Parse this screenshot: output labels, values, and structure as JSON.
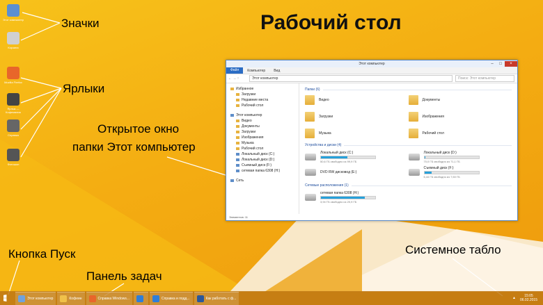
{
  "title": "Рабочий стол",
  "callouts": {
    "icons": "Значки",
    "shortcuts": "Ярлыки",
    "window_line1": "Открытое окно",
    "window_line2": "папки Этот компьютер",
    "start_button": "Кнопка Пуск",
    "taskbar": "Панель задач",
    "tray": "Системное табло"
  },
  "desktop_icons": [
    {
      "label": "Этот компьютер",
      "icon": "computer-icon",
      "color": "#5b8fd1"
    },
    {
      "label": "Корзина",
      "icon": "trash-icon",
      "color": "#d0d0d0"
    },
    {
      "label": "Mozilla Firefox",
      "icon": "firefox-icon",
      "color": "#e8662a"
    },
    {
      "label": "Ярлык — Кофемания",
      "icon": "app-icon",
      "color": "#444444"
    },
    {
      "label": "Справка",
      "icon": "help-icon",
      "color": "#666666"
    },
    {
      "label": "Фотошоп",
      "icon": "photo-icon",
      "color": "#555555"
    }
  ],
  "window": {
    "title": "Этот компьютер",
    "ribbon": [
      "Файл",
      "Компьютер",
      "Вид"
    ],
    "address": "Этот компьютер",
    "search_placeholder": "Поиск: Этот компьютер",
    "nav": {
      "favorites": "Избранное",
      "fav_items": [
        "Загрузки",
        "Недавние места",
        "Рабочий стол"
      ],
      "computer": "Этот компьютер",
      "computer_items": [
        "Видео",
        "Документы",
        "Загрузки",
        "Изображения",
        "Музыка",
        "Рабочий стол",
        "Локальный диск (C:)",
        "Локальный диск (D:)",
        "Съемный диск (F:)",
        "сетевая папка 6308 (H:)"
      ],
      "network": "Сеть"
    },
    "folders_header": "Папки (6)",
    "folders": [
      "Видео",
      "Документы",
      "Загрузки",
      "Изображения",
      "Музыка",
      "Рабочий стол"
    ],
    "devices_header": "Устройства и диски (4)",
    "drives": [
      {
        "name": "Локальный диск (C:)",
        "free": "50,6 ГБ свободно из 99,9 ГБ",
        "used": 0.49
      },
      {
        "name": "Локальный диск (D:)",
        "free": "70,0 ГБ свободно из 71,1 ГБ",
        "used": 0.02
      },
      {
        "name": "DVD RW дисковод (E:)",
        "free": "",
        "used": 0
      },
      {
        "name": "Съемный диск (F:)",
        "free": "6,44 ГБ свободно из 7,50 ГБ",
        "used": 0.14
      }
    ],
    "network_header": "Сетевые расположения (1)",
    "network_drive": {
      "name": "сетевая папка 6308 (H:)",
      "free": "3,94 ГБ свободно из 20,9 ГБ",
      "used": 0.81
    },
    "status": "Элементов: 11"
  },
  "taskbar": {
    "items": [
      {
        "label": "Этот компьютер",
        "color": "#6fa2de"
      },
      {
        "label": "Кофеин",
        "color": "#f0c14a"
      },
      {
        "label": "Справка Windows...",
        "color": "#e8662a"
      },
      {
        "label": "",
        "color": "#2f7ed8"
      },
      {
        "label": "Справка и подд...",
        "color": "#2f7ed8"
      },
      {
        "label": "Как работать с ф...",
        "color": "#2b579a"
      }
    ],
    "time": "15:05",
    "date": "06.02.2015"
  }
}
